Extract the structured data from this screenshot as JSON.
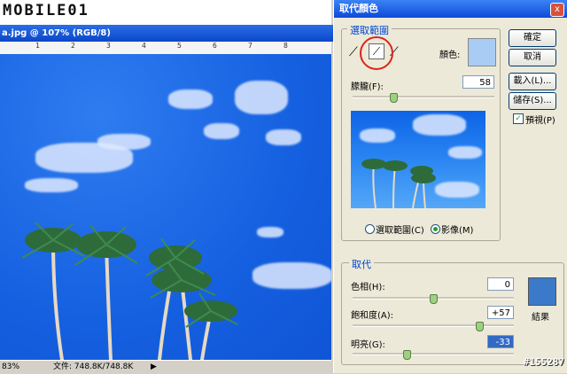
{
  "logo": {
    "text_a": "MOBILE",
    "text_b": "01"
  },
  "document": {
    "title": "a.jpg @ 107% (RGB/8)",
    "ruler_marks": [
      "1",
      "2",
      "3",
      "4",
      "5",
      "6",
      "7",
      "8"
    ],
    "zoom": "83%",
    "status_text": "文件: 748.8K/748.8K"
  },
  "dialog": {
    "title": "取代顏色",
    "close_label": "x",
    "selection_group": {
      "label": "選取範圍",
      "color_label": "顏色:",
      "color_value": "#a9ccf5"
    },
    "fuzziness": {
      "label": "朦朧(F):",
      "value": "58",
      "fraction": 0.29
    },
    "view_options": [
      {
        "label": "選取範圍(C)",
        "selected": false
      },
      {
        "label": "影像(M)",
        "selected": true
      }
    ],
    "buttons": {
      "ok": "確定",
      "cancel": "取消",
      "load": "載入(L)...",
      "save": "儲存(S)..."
    },
    "preview_label": "預視(P)",
    "preview_checked": true,
    "replace_group": {
      "label": "取代",
      "hue": {
        "label": "色相(H):",
        "value": "0",
        "fraction": 0.5
      },
      "saturation": {
        "label": "飽和度(A):",
        "value": "+57",
        "fraction": 0.785
      },
      "lightness": {
        "label": "明亮(G):",
        "value": "-33",
        "fraction": 0.335
      },
      "result_label": "結果",
      "result_color": "#3b79c9"
    }
  },
  "watermark": "#155287",
  "colors": {
    "accent": "#0046d5",
    "sky": "#1560e0",
    "highlight_circle": "#d9261c"
  }
}
